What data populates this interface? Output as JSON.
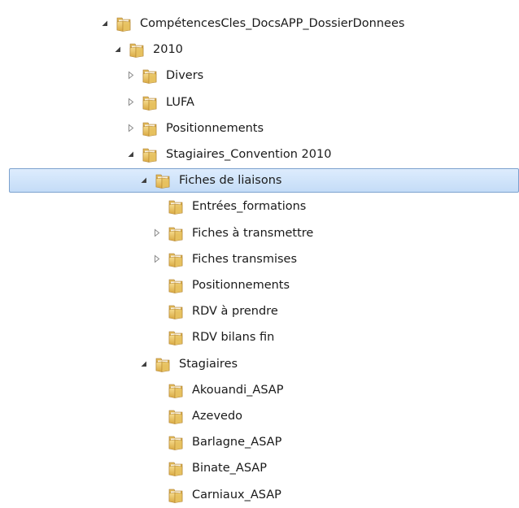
{
  "tree": {
    "items": [
      {
        "label": "CompétencesCles_DocsAPP_DossierDonnees",
        "depth": 0,
        "toggle": "expanded"
      },
      {
        "label": "2010",
        "depth": 1,
        "toggle": "expanded"
      },
      {
        "label": "Divers",
        "depth": 2,
        "toggle": "collapsed"
      },
      {
        "label": "LUFA",
        "depth": 2,
        "toggle": "collapsed"
      },
      {
        "label": "Positionnements",
        "depth": 2,
        "toggle": "collapsed"
      },
      {
        "label": "Stagiaires_Convention 2010",
        "depth": 2,
        "toggle": "expanded"
      },
      {
        "label": "Fiches de liaisons",
        "depth": 3,
        "toggle": "expanded",
        "selected": true
      },
      {
        "label": "Entrées_formations",
        "depth": 4,
        "toggle": "none"
      },
      {
        "label": "Fiches à transmettre",
        "depth": 4,
        "toggle": "collapsed"
      },
      {
        "label": "Fiches transmises",
        "depth": 4,
        "toggle": "collapsed"
      },
      {
        "label": "Positionnements",
        "depth": 4,
        "toggle": "none"
      },
      {
        "label": "RDV à prendre",
        "depth": 4,
        "toggle": "none"
      },
      {
        "label": "RDV bilans fin",
        "depth": 4,
        "toggle": "none"
      },
      {
        "label": "Stagiaires",
        "depth": 3,
        "toggle": "expanded"
      },
      {
        "label": "Akouandi_ASAP",
        "depth": 4,
        "toggle": "none"
      },
      {
        "label": "Azevedo",
        "depth": 4,
        "toggle": "none"
      },
      {
        "label": "Barlagne_ASAP",
        "depth": 4,
        "toggle": "none"
      },
      {
        "label": "Binate_ASAP",
        "depth": 4,
        "toggle": "none"
      },
      {
        "label": "Carniaux_ASAP",
        "depth": 4,
        "toggle": "none"
      }
    ]
  },
  "colors": {
    "selection_fill": "#cce2fa",
    "selection_border": "#7da2ce",
    "folder": "#e8c268"
  },
  "icons": {
    "folder": "folder-icon",
    "expanded": "expanded-arrow-icon",
    "collapsed": "collapsed-arrow-icon"
  }
}
